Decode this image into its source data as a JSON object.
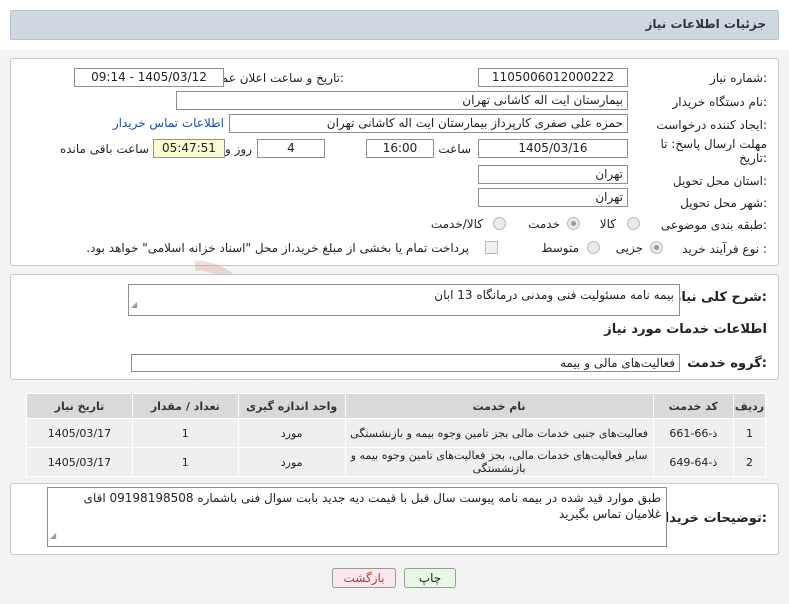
{
  "header": {
    "title": "جزئیات اطلاعات نیاز"
  },
  "form": {
    "need_number_label": "شماره نیاز:",
    "need_number": "1105006012000222",
    "announce_label": "تاریخ و ساعت اعلان عمومی:",
    "announce_value": "1405/03/12 - 09:14",
    "buyer_org_label": "نام دستگاه خریدار:",
    "buyer_org": "بیمارستان ایت اله کاشانی تهران",
    "creator_label": "ایجاد کننده درخواست:",
    "creator": "حمزه علی صفری کارپرداز بیمارستان ایت اله کاشانی تهران",
    "contact_link": "اطلاعات تماس خریدار",
    "deadline_label_1": "مهلت ارسال پاسخ: تا",
    "deadline_label_2": "تاریخ:",
    "deadline_date": "1405/03/16",
    "time_label": "ساعت",
    "deadline_time": "16:00",
    "days_value": "4",
    "days_label": "روز و",
    "remaining_time": "05:47:51",
    "remaining_label": "ساعت باقی مانده",
    "province_label": "استان محل تحویل:",
    "province": "تهران",
    "city_label": "شهر محل تحویل:",
    "city": "تهران",
    "category_label": "طبقه بندی موضوعی:",
    "category_options": [
      "کالا",
      "خدمت",
      "کالا/خدمت"
    ],
    "category_selected": "خدمت",
    "process_label": "نوع فرآیند خرید :",
    "process_options": [
      "جزیی",
      "متوسط"
    ],
    "process_selected": "جزیی",
    "payment_note": "پرداخت تمام یا بخشی از مبلغ خرید،از محل \"اسناد خزانه اسلامی\" خواهد بود."
  },
  "summary": {
    "label": "شرح کلی نیاز:",
    "value": "بیمه نامه مسئولیت فنی ومدنی درمانگاه 13 ابان"
  },
  "services": {
    "section_title": "اطلاعات خدمات مورد نیاز",
    "group_label": "گروه خدمت:",
    "group_value": "فعالیت‌های مالی و بیمه",
    "columns": [
      "ردیف",
      "کد خدمت",
      "نام خدمت",
      "واحد اندازه گیری",
      "تعداد / مقدار",
      "تاریخ نیاز"
    ],
    "rows": [
      {
        "row": "1",
        "code": "ذ-66-661",
        "name": "فعالیت‌های جنبی خدمات مالی بجز تامین وجوه بیمه و بازنشستگی",
        "unit": "مورد",
        "qty": "1",
        "date": "1405/03/17"
      },
      {
        "row": "2",
        "code": "ذ-64-649",
        "name": "سایر فعالیت‌های خدمات مالی، بجز فعالیت‌های تامین وجوه بیمه و بازنشستگی",
        "unit": "مورد",
        "qty": "1",
        "date": "1405/03/17"
      }
    ]
  },
  "notes": {
    "label": "توضیحات خریدار:",
    "value": "طبق موارد قید شده در بیمه نامه پیوست سال قبل با قیمت دیه جدید بابت سوال فنی باشماره 09198198508 اقای غلامیان تماس بگیرید"
  },
  "buttons": {
    "print": "چاپ",
    "back": "بازگشت"
  },
  "watermark": {
    "text": "AriaTender.net"
  },
  "colors": {
    "header_bg": "#cfd8e2",
    "link": "#1a4fb0",
    "print_btn_bg": "#e9f7e6",
    "back_btn_bg": "#fbe7ee",
    "remaining_bg": "#fdfbd2"
  }
}
